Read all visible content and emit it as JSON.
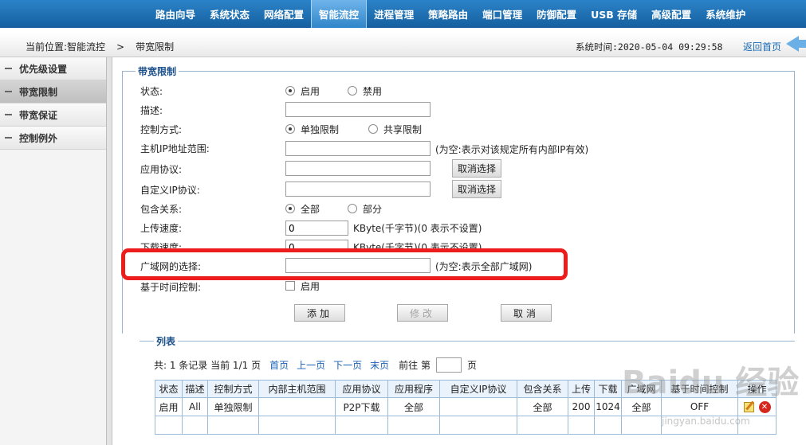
{
  "nav": {
    "items": [
      "路由向导",
      "系统状态",
      "网络配置",
      "智能流控",
      "进程管理",
      "策略路由",
      "端口管理",
      "防御配置",
      "USB 存储",
      "高级配置",
      "系统维护"
    ],
    "active_index": 3
  },
  "breadcrumb": {
    "prefix": "当前位置:智能流控",
    "separator": ">",
    "current": "带宽限制"
  },
  "system_time": "系统时间:2020-05-04 09:29:58",
  "back_home": "返回首页",
  "sidebar": {
    "items": [
      "优先级设置",
      "带宽限制",
      "带宽保证",
      "控制例外"
    ],
    "active_index": 1
  },
  "form": {
    "legend": "带宽限制",
    "status_label": "状态:",
    "status_enable": "启用",
    "status_disable": "禁用",
    "desc_label": "描述:",
    "desc_value": "",
    "control_label": "控制方式:",
    "control_single": "单独限制",
    "control_shared": "共享限制",
    "ip_range_label": "主机IP地址范围:",
    "ip_range_value": "",
    "ip_range_hint": "(为空:表示对该规定所有内部IP有效)",
    "app_proto_label": "应用协议:",
    "app_proto_value": "",
    "custom_ip_proto_label": "自定义IP协议:",
    "custom_ip_proto_value": "",
    "cancel_select": "取消选择",
    "include_label": "包含关系:",
    "include_all": "全部",
    "include_part": "部分",
    "upload_label": "上传速度:",
    "upload_value": "0",
    "upload_hint": "KByte(千字节)(0 表示不设置)",
    "download_label": "下载速度:",
    "download_value": "0",
    "download_hint": "KByte(千字节)(0 表示不设置)",
    "wan_label": "广域网的选择:",
    "wan_value": "",
    "wan_hint": "(为空:表示全部广域网)",
    "time_ctrl_label": "基于时间控制:",
    "time_ctrl_enable": "启用",
    "btn_add": "添加",
    "btn_modify": "修改",
    "btn_cancel": "取消"
  },
  "list": {
    "title": "列表",
    "summary": "共: 1 条记录 当前 1/1 页",
    "first": "首页",
    "prev": "上一页",
    "next": "下一页",
    "last": "末页",
    "goto_prefix": "前往 第",
    "goto_suffix": "页",
    "goto_value": "",
    "columns": [
      "状态",
      "描述",
      "控制方式",
      "内部主机范围",
      "应用协议",
      "应用程序",
      "自定义IP协议",
      "包含关系",
      "上传",
      "下载",
      "广域网",
      "基于时间控制",
      "操作"
    ],
    "rows": [
      [
        "启用",
        "All",
        "单独限制",
        "",
        "P2P下载",
        "全部",
        "",
        "全部",
        "200",
        "1024",
        "全部",
        "OFF",
        ""
      ]
    ]
  },
  "watermark": {
    "text": "Baidu 经验",
    "sub": "jingyan.baidu.com"
  }
}
